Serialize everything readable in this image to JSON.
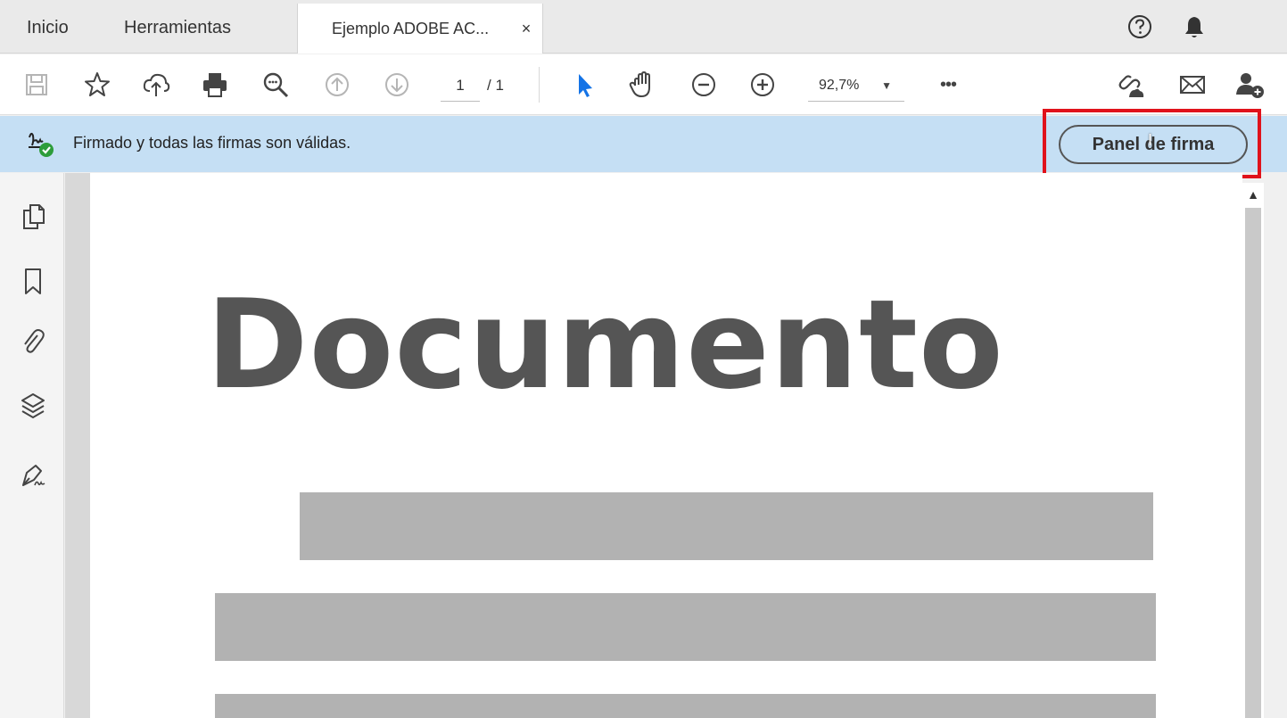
{
  "tabs": {
    "home": "Inicio",
    "tools": "Herramientas",
    "document": "Ejemplo ADOBE AC...",
    "close": "×"
  },
  "top_icons": [
    "help-icon",
    "notifications-bell-icon"
  ],
  "toolbar": {
    "icons": [
      "save-icon",
      "bookmark-star-icon",
      "cloud-upload-icon",
      "print-icon",
      "search-zoom-icon",
      "page-up-icon",
      "page-down-icon",
      "select-pointer-icon",
      "hand-tool-icon",
      "zoom-out-icon",
      "zoom-in-icon",
      "more-options-icon",
      "share-link-icon",
      "email-icon",
      "add-user-icon"
    ],
    "page_current": "1",
    "page_total": "/ 1",
    "zoom": "92,7%",
    "more": "•••"
  },
  "signature_bar": {
    "message": "Firmado y todas las firmas son válidas.",
    "button": "Panel de firma"
  },
  "left_rail": [
    "page-thumbnails-icon",
    "bookmarks-icon",
    "attachments-icon",
    "layers-icon",
    "signatures-icon"
  ],
  "document": {
    "title": "Documento"
  },
  "colors": {
    "banner": "#c5dff4",
    "highlight": "#e0121b",
    "select_tool": "#1473e6",
    "document_title": "#555555",
    "placeholder_bar": "#b2b2b2"
  }
}
